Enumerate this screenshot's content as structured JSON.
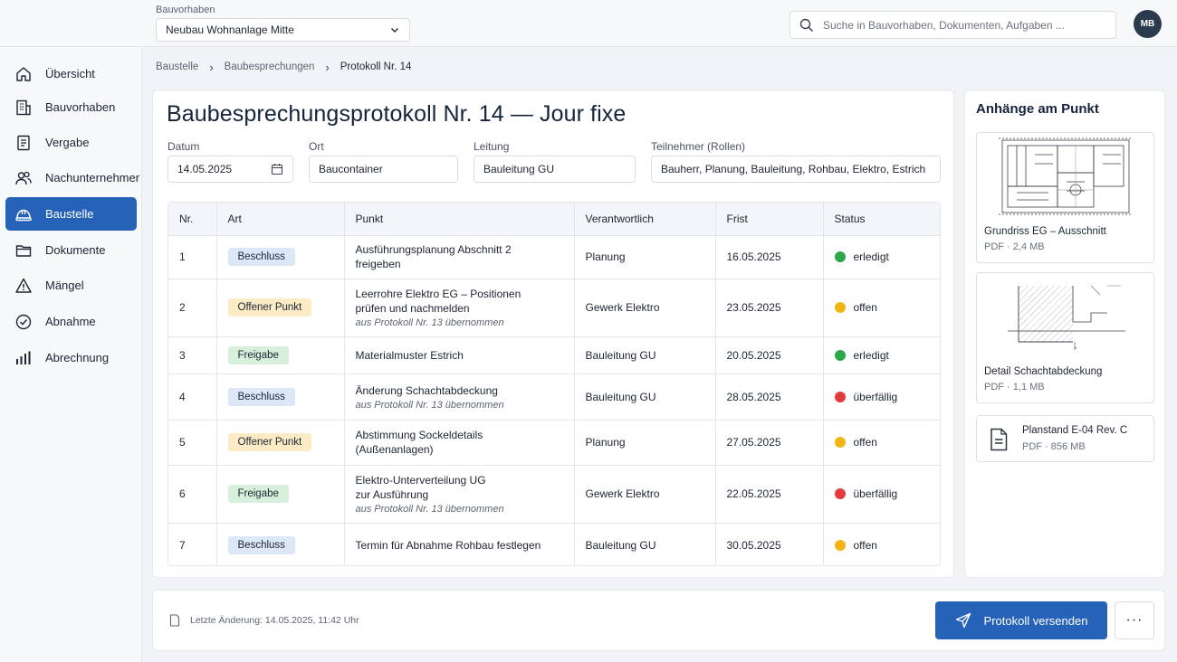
{
  "header": {
    "project_label": "Bauvorhaben",
    "project_value": "Neubau Wohnanlage Mitte",
    "search_placeholder": "Suche in Bauvorhaben, Dokumenten, Aufgaben ...",
    "avatar_initials": "MB"
  },
  "sidebar": {
    "items": [
      {
        "label": "Übersicht",
        "icon": "home-icon"
      },
      {
        "label": "Bauvorhaben",
        "icon": "building-icon"
      },
      {
        "label": "Vergabe",
        "icon": "document-list-icon"
      },
      {
        "label": "Nachunternehmer",
        "icon": "users-icon"
      },
      {
        "label": "Baustelle",
        "icon": "hardhat-icon",
        "active": true
      },
      {
        "label": "Dokumente",
        "icon": "folder-icon"
      },
      {
        "label": "Mängel",
        "icon": "warning-icon"
      },
      {
        "label": "Abnahme",
        "icon": "check-circle-icon"
      },
      {
        "label": "Abrechnung",
        "icon": "bar-chart-icon"
      }
    ]
  },
  "breadcrumb": [
    "Baustelle",
    "Baubesprechungen",
    "Protokoll Nr. 14"
  ],
  "protocol": {
    "title": "Baubesprechungsprotokoll Nr. 14  — Jour fixe",
    "fields": {
      "datum_label": "Datum",
      "datum_value": "14.05.2025",
      "ort_label": "Ort",
      "ort_value": "Baucontainer",
      "leitung_label": "Leitung",
      "leitung_value": "Bauleitung GU",
      "teilnehmer_label": "Teilnehmer (Rollen)",
      "teilnehmer_value": "Bauherr, Planung, Bauleitung, Rohbau, Elektro, Estrich"
    },
    "table": {
      "headers": [
        "Nr.",
        "Art",
        "Punkt",
        "Verantwortlich",
        "Frist",
        "Status"
      ],
      "rows": [
        {
          "nr": "1",
          "art": "Beschluss",
          "art_type": "beschluss",
          "punkt": [
            "Ausführungsplanung Abschnitt 2",
            "freigeben"
          ],
          "sub": "",
          "verantwortlich": "Planung",
          "frist": "16.05.2025",
          "status": "erledigt",
          "status_color": "#2aa84a"
        },
        {
          "nr": "2",
          "art": "Offener Punkt",
          "art_type": "offener",
          "punkt": [
            "Leerrohre Elektro EG – Positionen",
            "prüfen und nachmelden"
          ],
          "sub": "aus Protokoll Nr. 13 übernommen",
          "verantwortlich": "Gewerk Elektro",
          "frist": "23.05.2025",
          "status": "offen",
          "status_color": "#f2b514"
        },
        {
          "nr": "3",
          "art": "Freigabe",
          "art_type": "freigabe",
          "punkt": [
            "Materialmuster Estrich"
          ],
          "sub": "",
          "verantwortlich": "Bauleitung GU",
          "frist": "20.05.2025",
          "status": "erledigt",
          "status_color": "#2aa84a"
        },
        {
          "nr": "4",
          "art": "Beschluss",
          "art_type": "beschluss",
          "punkt": [
            "Änderung Schachtabdeckung"
          ],
          "sub": "aus Protokoll Nr. 13 übernommen",
          "verantwortlich": "Bauleitung GU",
          "frist": "28.05.2025",
          "status": "überfällig",
          "status_color": "#e23b3b"
        },
        {
          "nr": "5",
          "art": "Offener Punkt",
          "art_type": "offener",
          "punkt": [
            "Abstimmung Sockeldetails",
            "(Außenanlagen)"
          ],
          "sub": "",
          "verantwortlich": "Planung",
          "frist": "27.05.2025",
          "status": "offen",
          "status_color": "#f2b514"
        },
        {
          "nr": "6",
          "art": "Freigabe",
          "art_type": "freigabe",
          "punkt": [
            "Elektro-Unterverteilung UG",
            "zur Ausführung"
          ],
          "sub": "aus Protokoll Nr. 13 übernommen",
          "verantwortlich": "Gewerk Elektro",
          "frist": "22.05.2025",
          "status": "überfällig",
          "status_color": "#e23b3b"
        },
        {
          "nr": "7",
          "art": "Beschluss",
          "art_type": "beschluss",
          "punkt": [
            "Termin für Abnahme Rohbau festlegen"
          ],
          "sub": "",
          "verantwortlich": "Bauleitung GU",
          "frist": "30.05.2025",
          "status": "offen",
          "status_color": "#f2b514"
        }
      ]
    }
  },
  "attachments": {
    "title": "Anhänge am Punkt",
    "items": [
      {
        "name": "Grundriss EG – Ausschnitt",
        "meta": "PDF · 2,4 MB"
      },
      {
        "name": "Detail Schachtabdeckung",
        "meta": "PDF · 1,1 MB"
      },
      {
        "name": "Planstand E-04 Rev. C",
        "meta": "PDF · 856 MB"
      }
    ]
  },
  "footer": {
    "last_change": "Letzte Änderung: 14.05.2025, 11:42 Uhr",
    "send_label": "Protokoll versenden",
    "more_label": "···"
  }
}
